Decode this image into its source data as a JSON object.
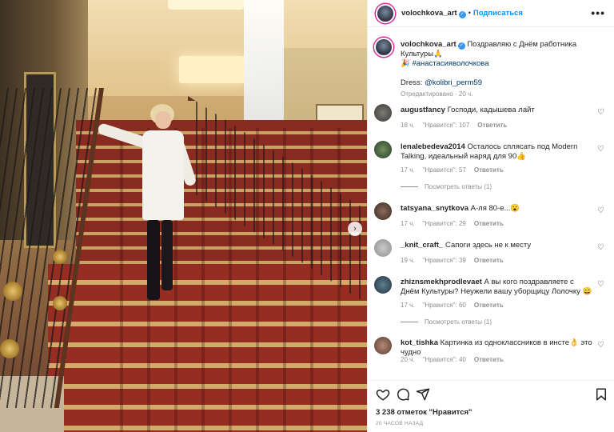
{
  "post": {
    "author": "volochkova_art",
    "follow_label": "Подписаться",
    "separator": "•",
    "more_label": "•••",
    "next_arrow": "›"
  },
  "caption": {
    "author": "volochkova_art",
    "text_1": "Поздравляю с Днём работника Культуры🙏",
    "hashtag": "#анастасияволочкова",
    "dress_prefix": "Dress: ",
    "dress_link": "@kolibri_perm59",
    "edited": "Отредактировано · 20 ч."
  },
  "comments": [
    {
      "user": "augustfancy",
      "text": "Господи, кадышева лайт",
      "time": "18 ч.",
      "likes": "\"Нравится\": 107",
      "reply": "Ответить",
      "replies": ""
    },
    {
      "user": "lenalebedeva2014",
      "text": "Осталось сплясать под Modern Talking, идеальный наряд для 90👍",
      "time": "17 ч.",
      "likes": "\"Нравится\": 57",
      "reply": "Ответить",
      "replies": "Посмотреть ответы (1)"
    },
    {
      "user": "tatsyana_snytkova",
      "text": "А-ля 80-е...😮",
      "time": "17 ч.",
      "likes": "\"Нравится\": 29",
      "reply": "Ответить",
      "replies": ""
    },
    {
      "user": "_knit_craft_",
      "text": "Сапоги здесь не к месту",
      "time": "19 ч.",
      "likes": "\"Нравится\": 39",
      "reply": "Ответить",
      "replies": ""
    },
    {
      "user": "zhiznsmekhprodlevaet",
      "text": "А вы кого поздравляете с Днём Культуры? Неужели вашу уборщицу Лолочку 😄",
      "time": "17 ч.",
      "likes": "\"Нравится\": 60",
      "reply": "Ответить",
      "replies": "Посмотреть ответы (1)"
    },
    {
      "user": "kot_tishka",
      "text": "Картинка из одноклассников в инсте👌 это чудно",
      "time": "20 ч.",
      "likes": "\"Нравится\": 40",
      "reply": "Ответить",
      "replies": ""
    }
  ],
  "footer": {
    "likes": "3 238 отметок \"Нравится\"",
    "time_ago": "20 ЧАСОВ НАЗАД"
  },
  "colors": {
    "accent": "#0095f6",
    "verified": "#3897f0",
    "muted": "#8e8e8e",
    "text": "#262626"
  },
  "icons": [
    "heart-icon",
    "comment-icon",
    "share-icon",
    "bookmark-icon",
    "more-icon",
    "verified-icon",
    "chevron-right-icon"
  ]
}
